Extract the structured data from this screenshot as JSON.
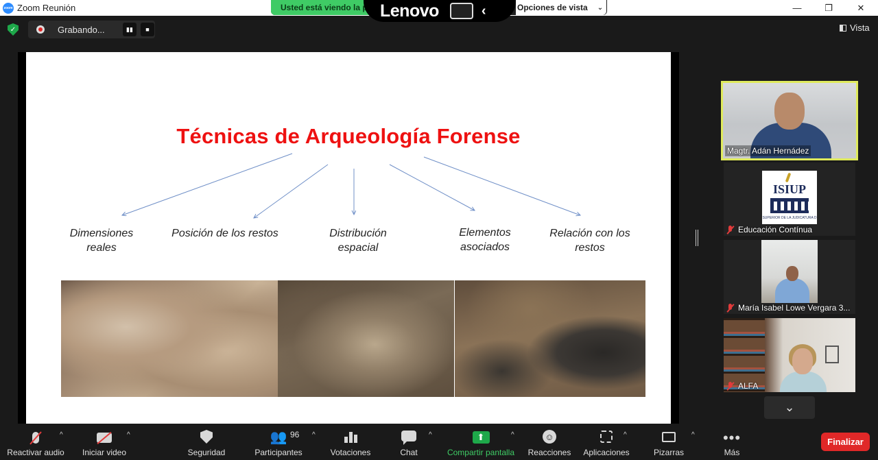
{
  "window": {
    "title": "Zoom Reunión",
    "logo_text": "zoom",
    "minimize": "—",
    "maximize": "❐",
    "close": "✕"
  },
  "share_banner": {
    "status_text": "Usted está viendo la pantalla",
    "brand": "Lenovo",
    "chevron": "‹",
    "view_options_label": "Opciones de vista",
    "view_options_chevron": "⌄"
  },
  "recording": {
    "label": "Grabando...",
    "pause": "▮▮",
    "stop": "■"
  },
  "view_button": {
    "label": "Vista"
  },
  "slide": {
    "title": "Técnicas de Arqueología Forense",
    "items": [
      {
        "line1": "Dimensiones",
        "line2": "reales"
      },
      {
        "line1": "Posición de los restos",
        "line2": ""
      },
      {
        "line1": "Distribución",
        "line2": "espacial"
      },
      {
        "line1": "Elementos",
        "line2": "asociados"
      },
      {
        "line1": "Relación  con  los",
        "line2": "restos"
      }
    ],
    "arrow_color": "#6f8fc7",
    "title_color": "#ee1111"
  },
  "participants": [
    {
      "name": "Magtr. Adán Hernádez",
      "muted": false,
      "active_speaker": true
    },
    {
      "name": "Educación Contínua",
      "muted": true,
      "logo_text": "ISIUP",
      "logo_subtext": "SUPERIOR DE LA JUDICATURA D"
    },
    {
      "name": "María Isabel Lowe Vergara 3...",
      "muted": true
    },
    {
      "name": "ALFA",
      "muted": true
    }
  ],
  "more_participants_chevron": "⌄",
  "toolbar": {
    "items": [
      {
        "label": "Reactivar audio"
      },
      {
        "label": "Iniciar video"
      },
      {
        "label": "Seguridad"
      },
      {
        "label": "Participantes",
        "count": "96"
      },
      {
        "label": "Votaciones"
      },
      {
        "label": "Chat"
      },
      {
        "label": "Compartir pantalla"
      },
      {
        "label": "Reacciones"
      },
      {
        "label": "Aplicaciones"
      },
      {
        "label": "Pizarras"
      },
      {
        "label": "Más"
      }
    ],
    "caret": "^",
    "end_label": "Finalizar",
    "end_color": "#e02828",
    "share_color": "#1ea84a"
  }
}
